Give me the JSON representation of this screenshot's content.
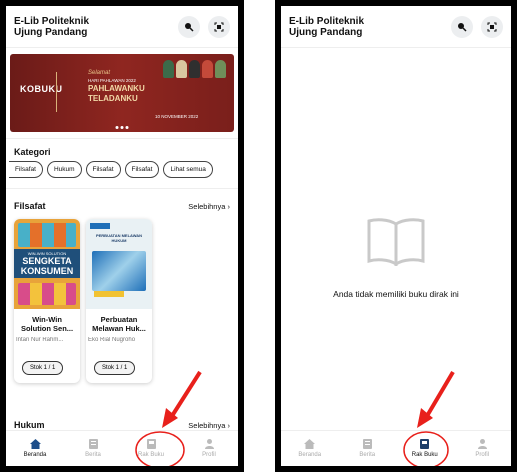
{
  "app": {
    "title_line1": "E-Lib Politeknik",
    "title_line2": "Ujung Pandang"
  },
  "banner": {
    "logo": "KOBUKU",
    "greeting": "Selamat",
    "subtitle": "HARI PAHLAWAN 2022",
    "headline1": "PAHLAWANKU",
    "headline2": "TELADANKU",
    "date": "10 NOVEMBER 2022"
  },
  "kategori": {
    "title": "Kategori",
    "chips": [
      "Filsafat",
      "Hukum",
      "Filsafat",
      "Filsafat",
      "Lihat semua"
    ]
  },
  "filsafat": {
    "title": "Filsafat",
    "more": "Selebihnya",
    "books": [
      {
        "title_line1": "Win-Win",
        "title_line2": "Solution Sen...",
        "author": "Intan Nur Rahm...",
        "stock": "Stok 1 / 1",
        "cover_line1": "WIN-WIN SOLUTION",
        "cover_line2": "SENGKETA",
        "cover_line3": "KONSUMEN"
      },
      {
        "title_line1": "Perbuatan",
        "title_line2": "Melawan Huk...",
        "author": "Eko Rial Nugroho",
        "stock": "Stok 1 / 1",
        "cover_line1": "PERBUATAN MELAWAN HUKUM"
      }
    ]
  },
  "hukum": {
    "title": "Hukum",
    "more": "Selebihnya"
  },
  "tabs": [
    "Beranda",
    "Berita",
    "Rak Buku",
    "Profil"
  ],
  "empty_state": {
    "message": "Anda tidak memiliki buku dirak ini"
  },
  "colors": {
    "banner": "#8f2620",
    "annotation": "#e8201b"
  }
}
